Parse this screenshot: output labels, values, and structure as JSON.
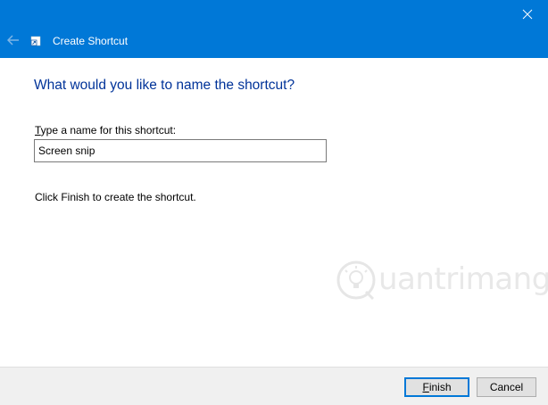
{
  "window": {
    "title": "Create Shortcut",
    "titlebar_color": "#0078d7"
  },
  "titlebar": {
    "back_icon": "back-arrow-icon",
    "close_icon": "close-icon",
    "app_icon": "shortcut-icon"
  },
  "content": {
    "heading": "What would you like to name the shortcut?",
    "heading_color": "#003399",
    "field_label_access_key": "T",
    "field_label_rest": "ype a name for this shortcut:",
    "name_value": "Screen snip",
    "info": "Click Finish to create the shortcut."
  },
  "watermark": {
    "text": "uantrimang",
    "logo_icon": "quantrimang-logo-icon"
  },
  "footer": {
    "finish_access_key": "F",
    "finish_rest": "inish",
    "cancel_label": "Cancel"
  }
}
